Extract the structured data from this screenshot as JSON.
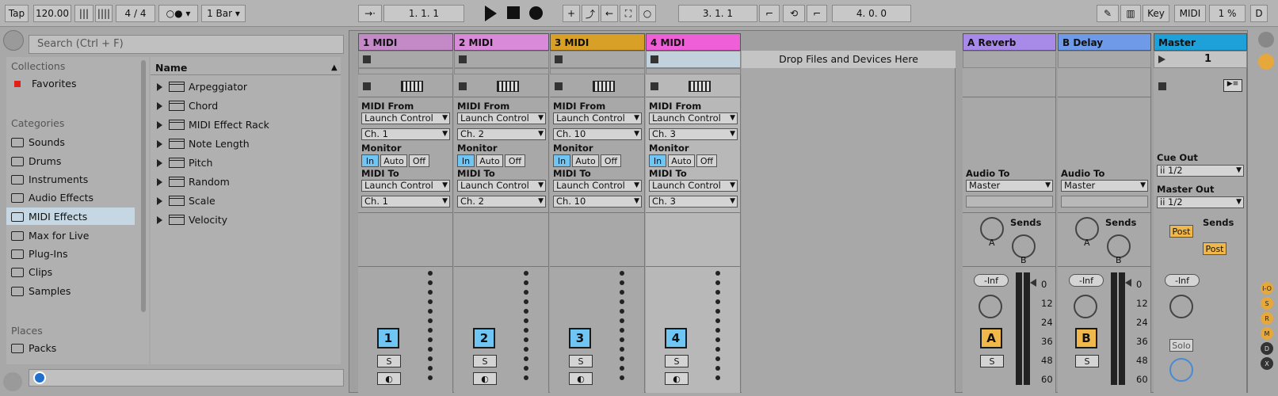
{
  "toolbar": {
    "tap": "Tap",
    "tempo": "120.00",
    "sig": "4 / 4",
    "quant": "1 Bar",
    "arr_pos": "1.  1.  1",
    "loop_start": "3.  1.  1",
    "loop_len": "4.  0.  0",
    "key": "Key",
    "midi": "MIDI",
    "cpu": "1 %",
    "d": "D"
  },
  "browser": {
    "search_placeholder": "Search (Ctrl + F)",
    "collections_title": "Collections",
    "favorites": "Favorites",
    "categories_title": "Categories",
    "categories": [
      "Sounds",
      "Drums",
      "Instruments",
      "Audio Effects",
      "MIDI Effects",
      "Max for Live",
      "Plug-Ins",
      "Clips",
      "Samples"
    ],
    "selected_category": "MIDI Effects",
    "places_title": "Places",
    "places": [
      "Packs"
    ],
    "name_header": "Name",
    "items": [
      "Arpeggiator",
      "Chord",
      "MIDI Effect Rack",
      "Note Length",
      "Pitch",
      "Random",
      "Scale",
      "Velocity"
    ]
  },
  "tracks": [
    {
      "name": "1 MIDI",
      "color": "#c48ac8",
      "channel_in": "Ch. 1",
      "channel_out": "Ch. 1",
      "number": "1"
    },
    {
      "name": "2 MIDI",
      "color": "#d98ad9",
      "channel_in": "Ch. 2",
      "channel_out": "Ch. 2",
      "number": "2"
    },
    {
      "name": "3 MIDI",
      "color": "#d9a028",
      "channel_in": "Ch. 10",
      "channel_out": "Ch. 10",
      "number": "3"
    },
    {
      "name": "4 MIDI",
      "color": "#ef5fd8",
      "channel_in": "Ch. 3",
      "channel_out": "Ch. 3",
      "number": "4"
    }
  ],
  "io": {
    "midi_from": "MIDI From",
    "launch": "Launch Control",
    "monitor": "Monitor",
    "in": "In",
    "auto": "Auto",
    "off": "Off",
    "midi_to": "MIDI To",
    "audio_to": "Audio To",
    "master": "Master",
    "cue_out": "Cue Out",
    "master_out": "Master Out",
    "one_two": "ii 1/2",
    "sends": "Sends",
    "post": "Post",
    "solo": "Solo",
    "s": "S",
    "inf": "-Inf",
    "a": "A",
    "b": "B"
  },
  "drop_text": "Drop Files and Devices Here",
  "returns": [
    {
      "name": "A Reverb",
      "color": "#a88ae8",
      "letter": "A"
    },
    {
      "name": "B Delay",
      "color": "#6f9ae8",
      "letter": "B"
    }
  ],
  "master": {
    "name": "Master",
    "color": "#1ea0d9",
    "scene": "1"
  },
  "meter_labels": [
    "0",
    "12",
    "24",
    "36",
    "48",
    "60"
  ],
  "right_btns": [
    "I-O",
    "S",
    "R",
    "M",
    "D",
    "X"
  ]
}
